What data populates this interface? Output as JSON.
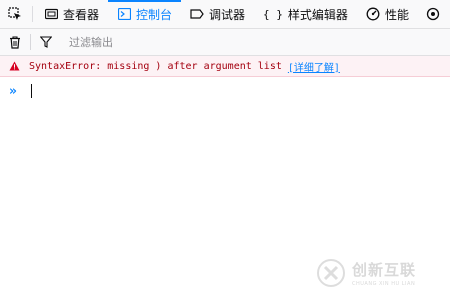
{
  "toolbar": {
    "tabs": [
      {
        "label": "查看器",
        "icon": "inspector-icon"
      },
      {
        "label": "控制台",
        "icon": "console-icon",
        "active": true
      },
      {
        "label": "调试器",
        "icon": "debugger-icon"
      },
      {
        "label": "样式编辑器",
        "icon": "style-editor-icon"
      },
      {
        "label": "性能",
        "icon": "performance-icon"
      }
    ]
  },
  "filter": {
    "placeholder": "过滤输出"
  },
  "console": {
    "error_message": "SyntaxError: missing ) after argument list",
    "learn_more": "[详细了解]",
    "prompt_symbol": "»"
  },
  "watermark": {
    "cn": "创新互联",
    "en": "CHUANG XIN HU LIAN"
  },
  "colors": {
    "accent": "#0a84ff",
    "error_text": "#a4000f",
    "error_bg": "#fdf2f5",
    "error_icon": "#d70022"
  }
}
